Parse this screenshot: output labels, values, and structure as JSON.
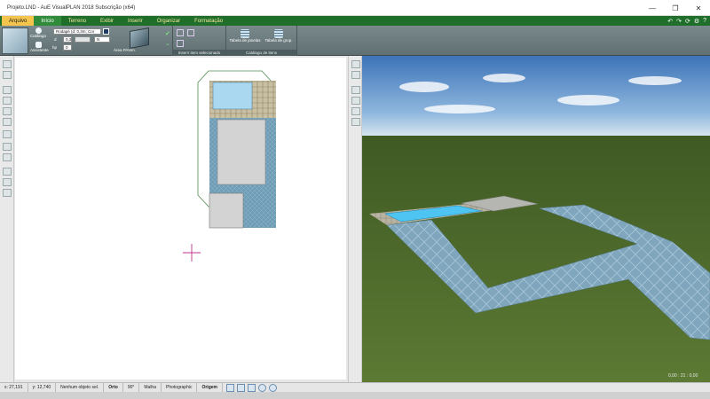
{
  "window": {
    "title": "Projeto.LND - AuE VisualPLAN 2018 Subscrição (x64)",
    "controls": [
      "—",
      "❐",
      "✕"
    ]
  },
  "menu": {
    "tabs": [
      "Arquivo",
      "Início",
      "Terreno",
      "Exibir",
      "Inserir",
      "Organizar",
      "Formatação"
    ],
    "active": "Início",
    "right_icons": [
      "↶",
      "↷",
      "⟳",
      "⚙",
      "?"
    ]
  },
  "ribbon": {
    "catalog_label": "Catálogo",
    "wizard_label": "Assistente",
    "combo_value": "Rodapé (d: 0,3m; Cor",
    "field_d_label": "d",
    "field_d_value": "0,3",
    "field_hp_label": "hp",
    "field_hp_value": "0",
    "dir_value": "N",
    "area_label": "Área PAVim.",
    "group_insert_label": "Inserir item selecionado",
    "table_windows_label": "Tabela de janelas",
    "table_grip_label": "Tabela de grup.",
    "group_catalog_label": "Catálogo de itens"
  },
  "view3d": {
    "coord_readout": "0,00 : 21 : 0,00"
  },
  "status": {
    "x": "x: 27,191",
    "y": "y: 12,740",
    "selection": "Nenhum objeto sel.",
    "orto": "Orto",
    "angle": "90°",
    "grid": "Malha",
    "render": "Photographic",
    "origin": "Origem"
  },
  "colors": {
    "menu_green": "#1f6e2a",
    "file_tab": "#f4c44c",
    "ribbon": "#6b7b7e",
    "grass": "#4d6a2c",
    "sky": "#4f86c6",
    "pool": "#7fd0f0",
    "tile": "#6f9db5"
  }
}
